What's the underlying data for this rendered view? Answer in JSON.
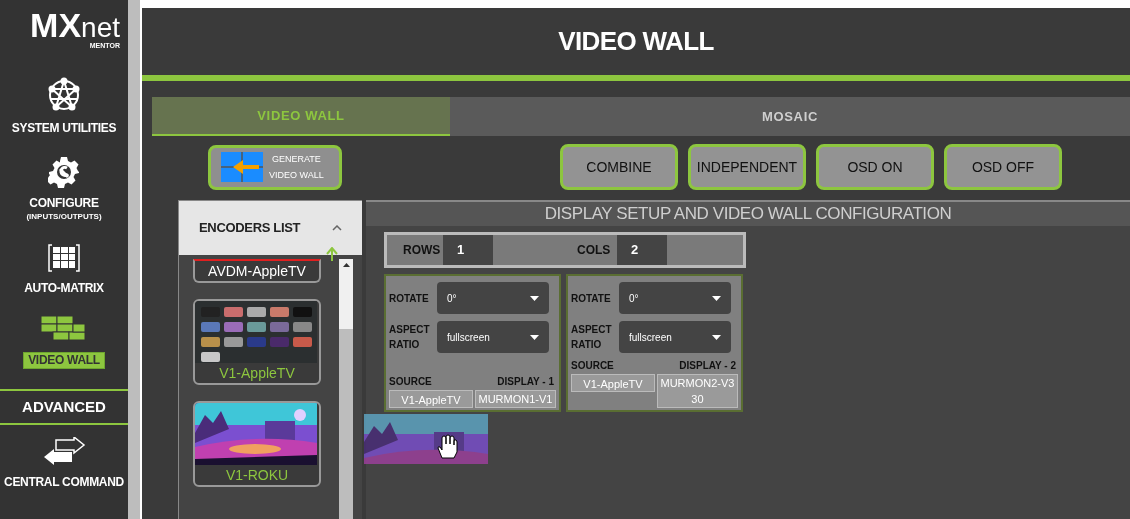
{
  "logo": {
    "main": "MX",
    "sub": "net",
    "tag": "MENTOR"
  },
  "sidebar": {
    "items": [
      {
        "kind": "network",
        "label": "SYSTEM UTILITIES",
        "selected": false
      },
      {
        "kind": "gear",
        "label": "CONFIGURE",
        "sublabel": "(INPUTS/OUTPUTS)",
        "selected": false
      },
      {
        "kind": "grid",
        "label": "AUTO-MATRIX",
        "selected": false
      },
      {
        "kind": "wall",
        "label": "VIDEO WALL",
        "selected": true
      },
      {
        "kind": "section",
        "label": "ADVANCED",
        "selected": false
      },
      {
        "kind": "arrows",
        "label": "CENTRAL COMMAND",
        "selected": false
      }
    ]
  },
  "header": {
    "title": "VIDEO WALL"
  },
  "tabs": [
    {
      "label": "VIDEO WALL",
      "selected": true
    },
    {
      "label": "MOSAIC",
      "selected": false
    }
  ],
  "generate_button": {
    "line1": "GENERATE",
    "line2": "VIDEO WALL"
  },
  "buttons": [
    "COMBINE",
    "INDEPENDENT",
    "OSD ON",
    "OSD OFF"
  ],
  "encoders": {
    "title": "ENCODERS LIST",
    "expanded": true,
    "items": [
      {
        "kind": "text",
        "label": "AVDM-AppleTV"
      },
      {
        "kind": "apps",
        "label": "V1-AppleTV"
      },
      {
        "kind": "scene",
        "label": "V1-ROKU"
      }
    ]
  },
  "config": {
    "title": "DISPLAY SETUP AND VIDEO WALL CONFIGURATION",
    "rows_label": "ROWS",
    "rows": "1",
    "cols_label": "COLS",
    "cols": "2",
    "displays": [
      {
        "rotate_label": "ROTATE",
        "rotate": "0°",
        "aspect_label": "ASPECT RATIO",
        "aspect": "fullscreen",
        "source_label": "SOURCE",
        "title": "DISPLAY - 1",
        "source": "V1-AppleTV",
        "output": "MURMON1-V1"
      },
      {
        "rotate_label": "ROTATE",
        "rotate": "0°",
        "aspect_label": "ASPECT RATIO",
        "aspect": "fullscreen",
        "source_label": "SOURCE",
        "title": "DISPLAY - 2",
        "source": "V1-AppleTV",
        "output": "MURMON2-V330"
      }
    ]
  }
}
